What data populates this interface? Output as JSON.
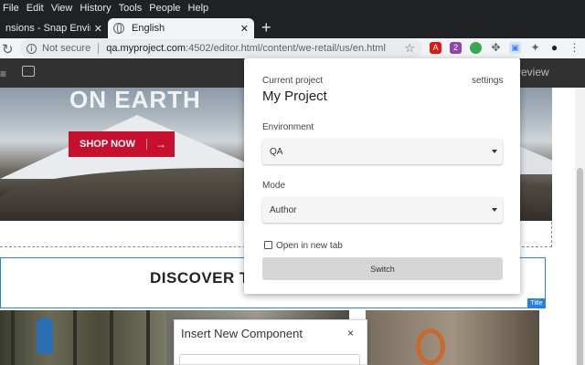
{
  "menubar": {
    "items": [
      "File",
      "Edit",
      "View",
      "History",
      "Tools",
      "People",
      "Help"
    ]
  },
  "tabs": [
    {
      "title": "nsions - Snap Environment",
      "close": "✕"
    },
    {
      "title": "English",
      "close": "✕"
    }
  ],
  "new_tab": "+",
  "address_bar": {
    "reload_icon": "↻",
    "info_icon": "i",
    "security_label": "Not secure",
    "url_host": "qa.myproject.com",
    "url_path": ":4502/editor.html/content/we-retail/us/en.html",
    "star_icon": "☆"
  },
  "extensions": [
    {
      "icon": "angular-icon",
      "glyph": "A",
      "color": "#dd1b16"
    },
    {
      "icon": "badge-ext-icon",
      "glyph": "2",
      "color": "#8e44ad"
    },
    {
      "icon": "color-ext-icon",
      "glyph": "",
      "color": "#34a853"
    },
    {
      "icon": "move-icon",
      "glyph": "✥",
      "color": "#5f6368"
    },
    {
      "icon": "snap-env-icon",
      "glyph": "▣",
      "color": "#4285f4"
    },
    {
      "icon": "puzzle-icon",
      "glyph": "✦",
      "color": "#5f6368"
    },
    {
      "icon": "profile-icon",
      "glyph": "●",
      "color": "#202124"
    },
    {
      "icon": "menu-dots-icon",
      "glyph": "⋮",
      "color": "#5f6368"
    }
  ],
  "page": {
    "preview_label": "review",
    "hero_title": "ON EARTH",
    "shop_button": "SHOP NOW",
    "shop_arrow": "→",
    "discover_title": "DISCOVER T",
    "title_tag": "Title",
    "insert_panel": {
      "title": "Insert New Component",
      "close": "×"
    }
  },
  "popup": {
    "current_project_label": "Current project",
    "settings_link": "settings",
    "project_name": "My Project",
    "environment_label": "Environment",
    "environment_value": "QA",
    "mode_label": "Mode",
    "mode_value": "Author",
    "open_new_tab_label": "Open in new tab",
    "open_new_tab_checked": false,
    "switch_button": "Switch"
  }
}
